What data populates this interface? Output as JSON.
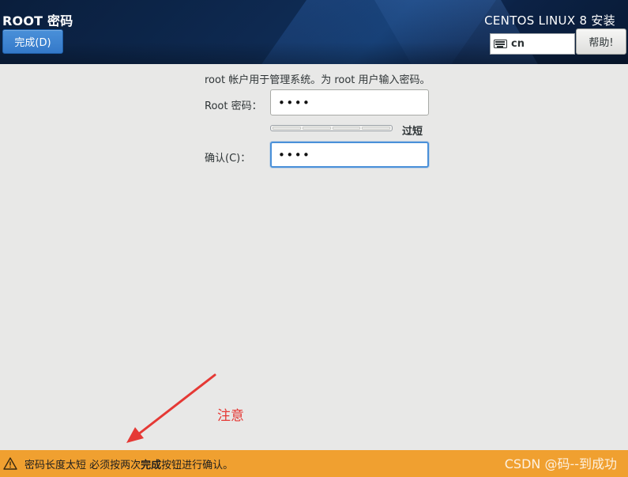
{
  "header": {
    "page_title": "ROOT 密码",
    "done_label": "完成(D)",
    "product_title": "CENTOS LINUX 8 安装",
    "keyboard_layout": "cn",
    "help_label": "帮助!",
    "keyboard_icon": "keyboard-icon"
  },
  "form": {
    "intro": "root 帐户用于管理系统。为 root 用户输入密码。",
    "password_label": "Root 密码：",
    "password_value": "••••",
    "strength_label": "过短",
    "confirm_label": "确认(C)：",
    "confirm_value": "••••"
  },
  "annotation": {
    "text": "注意",
    "color": "#e53935"
  },
  "warning": {
    "icon": "warning-icon",
    "text_before": "密码长度太短 必须按两次",
    "text_bold": "完成",
    "text_after": "按钮进行确认。",
    "color": "#f0a030"
  },
  "watermark": "CSDN @码--到成功"
}
